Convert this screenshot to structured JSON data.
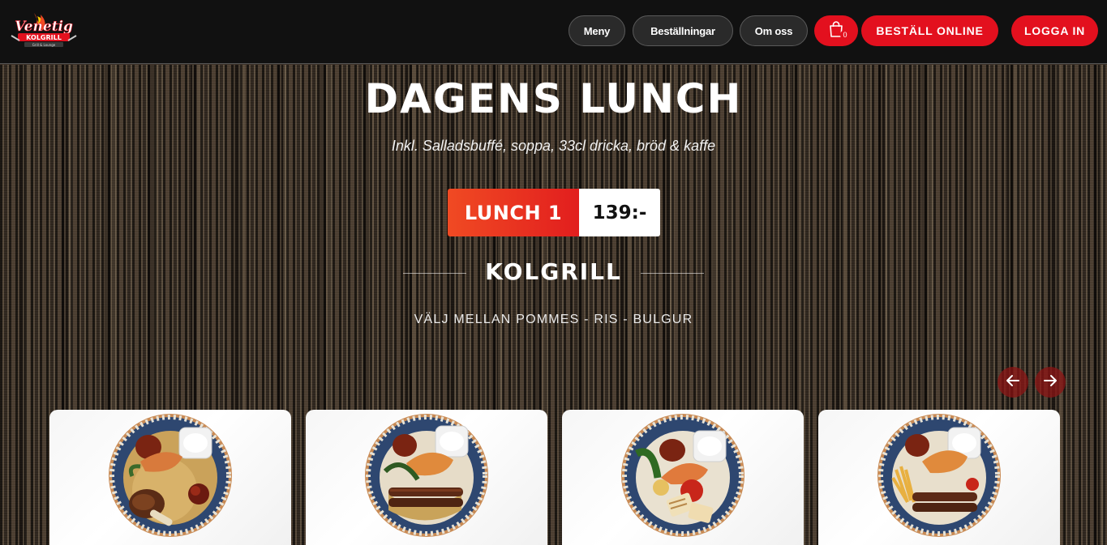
{
  "brand": {
    "logo_text": "Venetig",
    "logo_subtext": "KOLGRILL",
    "logo_tagline": "Grill & Lounge"
  },
  "nav": {
    "items": [
      {
        "label": "Meny"
      },
      {
        "label": "Beställningar"
      },
      {
        "label": "Om oss"
      }
    ],
    "cart": {
      "icon": "shopping-bag-icon",
      "count": "0"
    },
    "order_online": "BESTÄLL ONLINE",
    "login": "LOGGA IN"
  },
  "hero": {
    "title": "DAGENS LUNCH",
    "subtitle": "Inkl. Salladsbuffé, soppa, 33cl dricka, bröd & kaffe",
    "lunch_label": "LUNCH 1",
    "price": "139:-",
    "section_title": "KOLGRILL",
    "section_desc": "VÄLJ MELLAN POMMES - RIS - BULGUR"
  },
  "carousel": {
    "prev_icon": "arrow-left-icon",
    "next_icon": "arrow-right-icon",
    "items": [
      {
        "image": "lamb-shank-bulgur-plate"
      },
      {
        "image": "adana-kebab-bulgur-plate"
      },
      {
        "image": "halloumi-grilled-vegetables-plate"
      },
      {
        "image": "kebab-fries-plate"
      }
    ]
  },
  "colors": {
    "accent_red": "#e3101e",
    "lunch_orange": "#f04a23",
    "nav_bg": "#111111"
  }
}
